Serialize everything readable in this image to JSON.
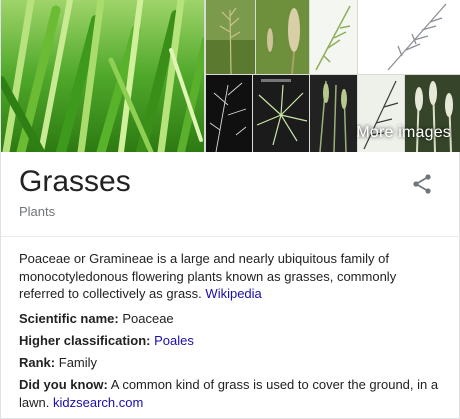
{
  "gallery": {
    "more_images_label": "More images"
  },
  "header": {
    "title": "Grasses",
    "subtitle": "Plants"
  },
  "description": {
    "text": "Poaceae or Gramineae is a large and nearly ubiquitous family of monocotyledonous flowering plants known as grasses, commonly referred to collectively as grass.",
    "source_link": "Wikipedia"
  },
  "facts": [
    {
      "label": "Scientific name:",
      "value": "Poaceae",
      "is_link": false
    },
    {
      "label": "Higher classification:",
      "value": "Poales",
      "is_link": true
    },
    {
      "label": "Rank:",
      "value": "Family",
      "is_link": false
    }
  ],
  "did_you_know": {
    "label": "Did you know:",
    "text": "A common kind of grass is used to cover the ground, in a lawn.",
    "source_link": "kidzsearch.com"
  },
  "icons": {
    "share": "share-icon"
  },
  "colors": {
    "link": "#1a0dab",
    "subtitle": "#70757a",
    "title": "#222222"
  }
}
